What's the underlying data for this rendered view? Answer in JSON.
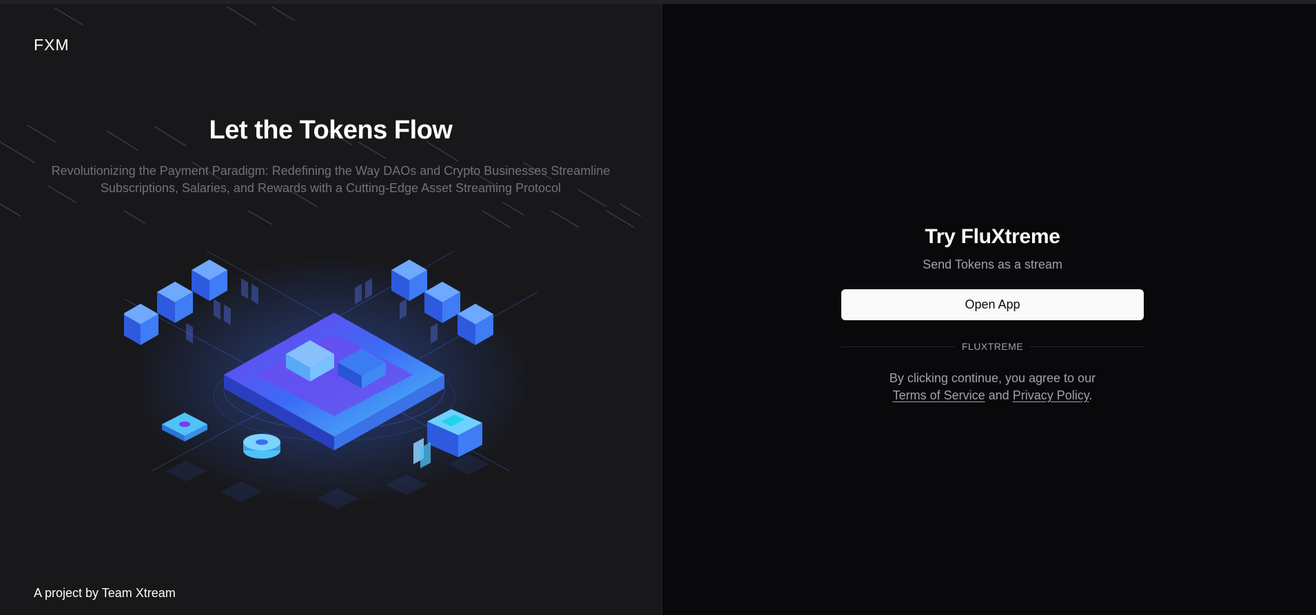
{
  "brand": {
    "logo_text": "FXM"
  },
  "hero": {
    "title": "Let the Tokens Flow",
    "subtitle": "Revolutionizing the Payment Paradigm: Redefining the Way DAOs and Crypto Businesses Streamline Subscriptions, Salaries, and Rewards with a Cutting-Edge Asset Streaming Protocol"
  },
  "footer": {
    "credit": "A project by Team Xtream"
  },
  "cta": {
    "title": "Try FluXtreme",
    "subtitle": "Send Tokens as a stream",
    "button_label": "Open App",
    "separator_label": "FLUXTREME",
    "terms_prefix": "By clicking continue, you agree to our",
    "terms_link": "Terms of Service",
    "terms_and": "and",
    "privacy_link": "Privacy Policy",
    "terms_suffix": "."
  },
  "colors": {
    "left_bg": "#18181b",
    "right_bg": "#09090b",
    "accent_blue": "#3b6cf6",
    "accent_purple": "#7c3aed",
    "accent_cyan": "#4fc3f7",
    "button_bg": "#fafafa",
    "muted_text": "#a1a1aa"
  }
}
